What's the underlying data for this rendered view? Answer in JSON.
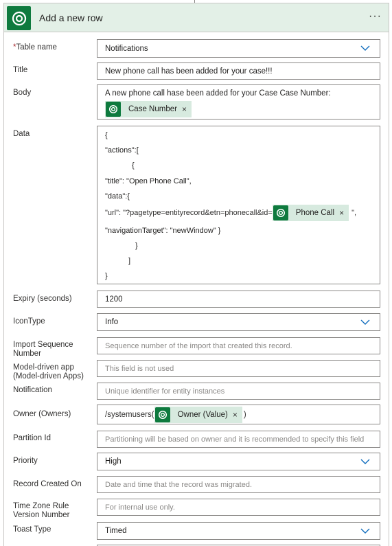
{
  "header": {
    "title": "Add a new row",
    "menu": "···"
  },
  "fields": {
    "table_name": {
      "label": "Table name",
      "required_mark": "*",
      "value": "Notifications"
    },
    "title": {
      "label": "Title",
      "value": "New phone call has been added for your case!!!"
    },
    "body": {
      "label": "Body",
      "value": "A new phone call hase been added for your Case Case Number:",
      "token": "Case Number"
    },
    "data": {
      "label": "Data",
      "lines": [
        "{",
        "\"actions\":[",
        "{",
        "\"title\": \"Open Phone Call\",",
        "\"data\":{",
        "\"navigationTarget\": \"newWindow\" }",
        "}",
        "]",
        "}"
      ],
      "url_prefix": "\"url\": \"?pagetype=entityrecord&etn=phonecall&id=",
      "url_token": "Phone Call",
      "url_suffix": "\","
    },
    "expiry": {
      "label": "Expiry (seconds)",
      "value": "1200"
    },
    "icon_type": {
      "label": "IconType",
      "value": "Info"
    },
    "import_sequence": {
      "label": "Import Sequence Number",
      "placeholder": "Sequence number of the import that created this record."
    },
    "model_driven_app": {
      "label": "Model-driven app (Model-driven Apps)",
      "placeholder": "This field is not used"
    },
    "notification": {
      "label": "Notification",
      "placeholder": "Unique identifier for entity instances"
    },
    "owner": {
      "label": "Owner (Owners)",
      "prefix": "/systemusers(",
      "token": "Owner (Value)",
      "suffix": ")"
    },
    "partition_id": {
      "label": "Partition Id",
      "placeholder": "Partitioning will be based on owner and it is recommended to specify this field"
    },
    "priority": {
      "label": "Priority",
      "value": "High"
    },
    "record_created_on": {
      "label": "Record Created On",
      "placeholder": "Date and time that the record was migrated."
    },
    "time_zone": {
      "label": "Time Zone Rule Version Number",
      "placeholder": "For internal use only."
    },
    "toast_type": {
      "label": "Toast Type",
      "value": "Timed"
    }
  },
  "icons": {
    "dataverse": "dataverse-icon",
    "chevron": "chevron-down-icon",
    "remove": "close-icon"
  },
  "colors": {
    "header_bg": "#e3f0e7",
    "icon_green": "#0e7a3e",
    "token_bg": "#d7eadf",
    "chevron": "#0f6cbd",
    "required": "#a4262c"
  }
}
